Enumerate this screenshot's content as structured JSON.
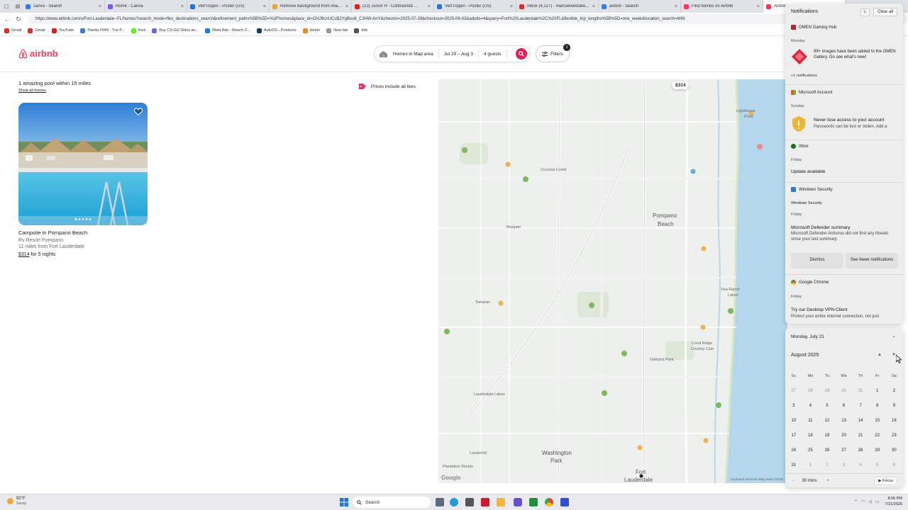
{
  "browser": {
    "tabs": [
      {
        "title": "canva - Search",
        "color": "#3b7be0"
      },
      {
        "title": "Home - Canva",
        "color": "#7d5be8"
      },
      {
        "title": "VertTrippin - Poster (US)",
        "color": "#2f6fd8"
      },
      {
        "title": "Remove Background from ima...",
        "color": "#e8a33b"
      },
      {
        "title": "(13) Junior H - Contrasndo ...",
        "color": "#e02020"
      },
      {
        "title": "VertTrippin - Poster (US)",
        "color": "#2f6fd8"
      },
      {
        "title": "Inbox (4,127) - manuelwestake...",
        "color": "#d93025"
      },
      {
        "title": "airbnb - Search",
        "color": "#3b7be0"
      },
      {
        "title": "Find homes on Airbnb",
        "color": "#ff385c"
      },
      {
        "title": "Airbnb | Fort L...",
        "color": "#ff385c"
      }
    ],
    "url": "https://www.airbnb.com/s/Fort-Lauderdale--FL/homes?search_mode=flex_destinations_search&refinement_paths%5B%5D=%2Fhomes&place_id=ChIJ9cnUCcB2YgBvo6_CJHW-AnY&checkin=2025-07-29&checkout=2025-08-03&adults=4&query=Fort%20Lauderdale%2C%20FL&flexible_trip_lengths%5B%5D=one_week&location_search=MIN",
    "bookmarks": [
      {
        "label": "Gmail",
        "color": "#d93025"
      },
      {
        "label": "Gmail",
        "color": "#d93025"
      },
      {
        "label": "YouTube",
        "color": "#e02020"
      },
      {
        "label": "Panda #044 - Tux P...",
        "color": "#3b7be0"
      },
      {
        "label": "Kick",
        "color": "#53fc18"
      },
      {
        "label": "Buy CS:GO Skins an...",
        "color": "#6b6bd8"
      },
      {
        "label": "Meta Ads - Reach C...",
        "color": "#1877f2"
      },
      {
        "label": "AutoDS - Products",
        "color": "#1e3a5f"
      },
      {
        "label": "Home",
        "color": "#f08a24"
      },
      {
        "label": "New tab",
        "color": "#999999"
      },
      {
        "label": "ddv",
        "color": "#555555"
      }
    ]
  },
  "airbnb": {
    "logo": "airbnb",
    "search": {
      "location": "Homes in Map area",
      "dates": "Jul 29 – Aug 3",
      "guests": "4 guests"
    },
    "filters": {
      "label": "Filters",
      "count": "1"
    },
    "results_title": "1 amazing pool within 15 miles",
    "show_all": "Show all homes",
    "prices_note": "Prices include all fees",
    "listing": {
      "title": "Campsite in Pompano Beach",
      "subtitle": "Rv Resort Pompano",
      "distance": "11 miles from Fort Lauderdale",
      "price": "$314",
      "price_suffix": " for 5 nights"
    },
    "map": {
      "price_pin": "$314",
      "labels": [
        "Coconut Creek",
        "Pompano",
        "Beach",
        "Lighthouse",
        "Point",
        "Sea Ranch",
        "Lakes",
        "Coral Ridge",
        "Country Club",
        "Lauderdale Lakes",
        "Lauderhill",
        "Washington",
        "Park",
        "Fort",
        "Lauderdale",
        "Plantation Woods",
        "Margate",
        "Tamarac",
        "Oakland Park"
      ],
      "google": "Google",
      "footer": "Keyboard shortcuts   Map Data ©2025"
    }
  },
  "notifications": {
    "title": "Notifications",
    "clear_all": "Clear all",
    "items": {
      "omen_app": "OMEN Gaming Hub",
      "omen_day": "Monday",
      "omen_text": "99+ images have been added to the OMEN Gallery. Go see what's new!",
      "omen_more": "+1 notifications",
      "ms_app": "Microsoft Account",
      "ms_day": "Sunday",
      "ms_title": "Never lose access to your account",
      "ms_body": "Passwords can be lost or stolen. Add a",
      "xbox_app": "Xbox",
      "xbox_day": "Friday",
      "xbox_title": "Update available",
      "ws_app": "Windows Security",
      "ws_sub": "Windows Security",
      "ws_day": "Friday",
      "ws_title": "Microsoft Defender summary",
      "ws_body": "Microsoft Defender Antivirus did not find any threats since your last summary.",
      "dismiss": "Dismiss",
      "see_fewer": "See fewer notifications",
      "gc_app": "Google Chrome",
      "gc_day": "Friday",
      "gc_title": "Try our Desktop VPN Client",
      "gc_body": "Protect your entire internet connection, not just"
    }
  },
  "calendar": {
    "date_label": "Monday, July 21",
    "month": "August 2025",
    "dow": [
      "Su",
      "Mo",
      "Tu",
      "We",
      "Th",
      "Fr",
      "Sa"
    ],
    "weeks": [
      [
        "27",
        "28",
        "29",
        "30",
        "31",
        "1",
        "2"
      ],
      [
        "3",
        "4",
        "5",
        "6",
        "7",
        "8",
        "9"
      ],
      [
        "10",
        "11",
        "12",
        "13",
        "14",
        "15",
        "16"
      ],
      [
        "17",
        "18",
        "19",
        "20",
        "21",
        "22",
        "23"
      ],
      [
        "24",
        "25",
        "26",
        "27",
        "28",
        "29",
        "30"
      ],
      [
        "31",
        "1",
        "2",
        "3",
        "4",
        "5",
        "6"
      ]
    ],
    "focus_minutes": "30 mins",
    "focus_label": "Focus"
  },
  "taskbar": {
    "weather_temp": "92°F",
    "weather_cond": "Sunny",
    "search": "Search",
    "time": "8:06 PM",
    "date": "7/21/2025"
  }
}
